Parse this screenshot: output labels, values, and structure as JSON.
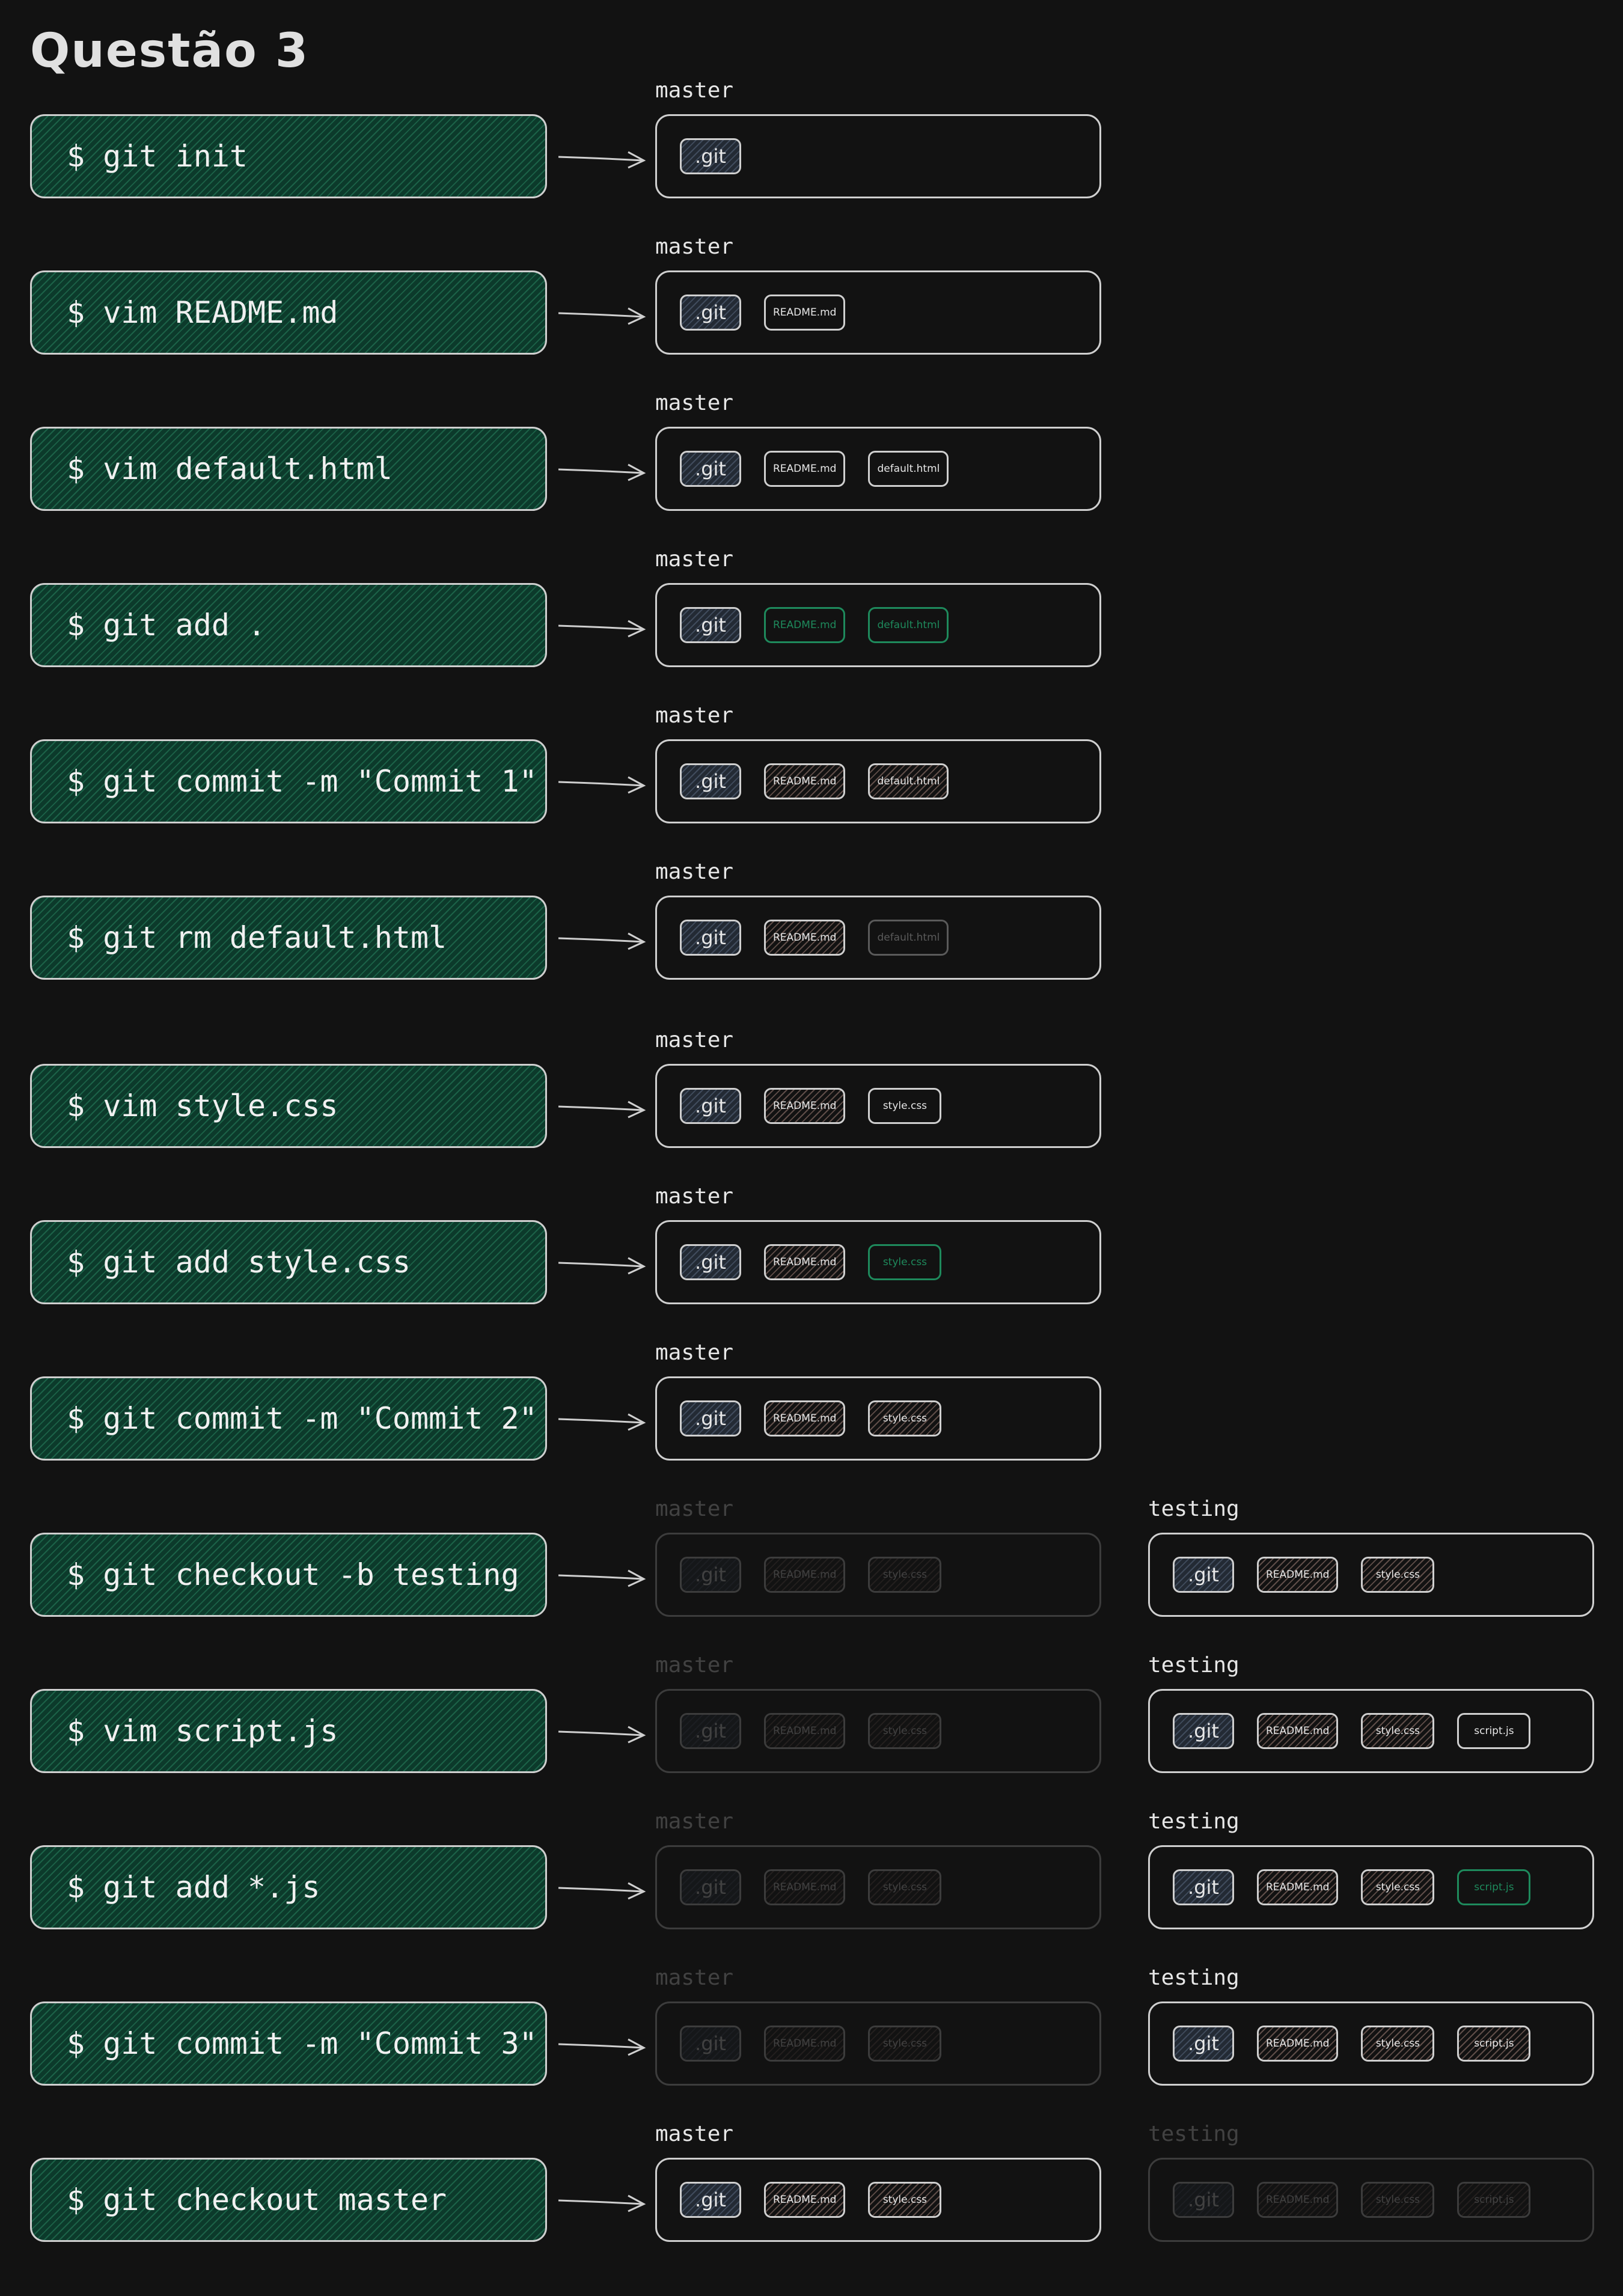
{
  "title": "Questão 3",
  "colors": {
    "background": "#121212",
    "command_fill": "#0c3a2b",
    "staged": "#1e8a5c",
    "border": "#cfcfcf"
  },
  "steps": [
    {
      "command": "$ git init",
      "branches": [
        {
          "name": "master",
          "active": true,
          "files": [
            {
              "name": ".git",
              "state": "git"
            }
          ]
        }
      ]
    },
    {
      "command": "$ vim README.md",
      "branches": [
        {
          "name": "master",
          "active": true,
          "files": [
            {
              "name": ".git",
              "state": "git"
            },
            {
              "name": "README.md",
              "state": "untracked"
            }
          ]
        }
      ]
    },
    {
      "command": "$ vim default.html",
      "branches": [
        {
          "name": "master",
          "active": true,
          "files": [
            {
              "name": ".git",
              "state": "git"
            },
            {
              "name": "README.md",
              "state": "untracked"
            },
            {
              "name": "default.html",
              "state": "untracked"
            }
          ]
        }
      ]
    },
    {
      "command": "$ git add .",
      "branches": [
        {
          "name": "master",
          "active": true,
          "files": [
            {
              "name": ".git",
              "state": "git"
            },
            {
              "name": "README.md",
              "state": "staged"
            },
            {
              "name": "default.html",
              "state": "staged"
            }
          ]
        }
      ]
    },
    {
      "command": "$ git commit -m \"Commit 1\"",
      "branches": [
        {
          "name": "master",
          "active": true,
          "files": [
            {
              "name": ".git",
              "state": "git"
            },
            {
              "name": "README.md",
              "state": "committed"
            },
            {
              "name": "default.html",
              "state": "committed"
            }
          ]
        }
      ]
    },
    {
      "command": "$ git rm default.html",
      "branches": [
        {
          "name": "master",
          "active": true,
          "files": [
            {
              "name": ".git",
              "state": "git"
            },
            {
              "name": "README.md",
              "state": "committed"
            },
            {
              "name": "default.html",
              "state": "removed"
            }
          ]
        }
      ]
    },
    {
      "command": "$ vim style.css",
      "branches": [
        {
          "name": "master",
          "active": true,
          "files": [
            {
              "name": ".git",
              "state": "git"
            },
            {
              "name": "README.md",
              "state": "committed"
            },
            {
              "name": "style.css",
              "state": "untracked"
            }
          ]
        }
      ]
    },
    {
      "command": "$ git add style.css",
      "branches": [
        {
          "name": "master",
          "active": true,
          "files": [
            {
              "name": ".git",
              "state": "git"
            },
            {
              "name": "README.md",
              "state": "committed"
            },
            {
              "name": "style.css",
              "state": "staged"
            }
          ]
        }
      ]
    },
    {
      "command": "$ git commit -m \"Commit 2\"",
      "branches": [
        {
          "name": "master",
          "active": true,
          "files": [
            {
              "name": ".git",
              "state": "git"
            },
            {
              "name": "README.md",
              "state": "committed"
            },
            {
              "name": "style.css",
              "state": "committed"
            }
          ]
        }
      ]
    },
    {
      "command": "$ git checkout -b testing",
      "branches": [
        {
          "name": "master",
          "active": false,
          "files": [
            {
              "name": ".git",
              "state": "git"
            },
            {
              "name": "README.md",
              "state": "committed"
            },
            {
              "name": "style.css",
              "state": "committed"
            }
          ]
        },
        {
          "name": "testing",
          "active": true,
          "files": [
            {
              "name": ".git",
              "state": "git"
            },
            {
              "name": "README.md",
              "state": "committed"
            },
            {
              "name": "style.css",
              "state": "committed"
            }
          ]
        }
      ]
    },
    {
      "command": "$ vim script.js",
      "branches": [
        {
          "name": "master",
          "active": false,
          "files": [
            {
              "name": ".git",
              "state": "git"
            },
            {
              "name": "README.md",
              "state": "committed"
            },
            {
              "name": "style.css",
              "state": "committed"
            }
          ]
        },
        {
          "name": "testing",
          "active": true,
          "files": [
            {
              "name": ".git",
              "state": "git"
            },
            {
              "name": "README.md",
              "state": "committed"
            },
            {
              "name": "style.css",
              "state": "committed"
            },
            {
              "name": "script.js",
              "state": "untracked"
            }
          ]
        }
      ]
    },
    {
      "command": "$ git add *.js",
      "branches": [
        {
          "name": "master",
          "active": false,
          "files": [
            {
              "name": ".git",
              "state": "git"
            },
            {
              "name": "README.md",
              "state": "committed"
            },
            {
              "name": "style.css",
              "state": "committed"
            }
          ]
        },
        {
          "name": "testing",
          "active": true,
          "files": [
            {
              "name": ".git",
              "state": "git"
            },
            {
              "name": "README.md",
              "state": "committed"
            },
            {
              "name": "style.css",
              "state": "committed"
            },
            {
              "name": "script.js",
              "state": "staged"
            }
          ]
        }
      ]
    },
    {
      "command": "$ git commit -m \"Commit 3\"",
      "branches": [
        {
          "name": "master",
          "active": false,
          "files": [
            {
              "name": ".git",
              "state": "git"
            },
            {
              "name": "README.md",
              "state": "committed"
            },
            {
              "name": "style.css",
              "state": "committed"
            }
          ]
        },
        {
          "name": "testing",
          "active": true,
          "files": [
            {
              "name": ".git",
              "state": "git"
            },
            {
              "name": "README.md",
              "state": "committed"
            },
            {
              "name": "style.css",
              "state": "committed"
            },
            {
              "name": "script.js",
              "state": "committed"
            }
          ]
        }
      ]
    },
    {
      "command": "$ git checkout master",
      "branches": [
        {
          "name": "master",
          "active": true,
          "files": [
            {
              "name": ".git",
              "state": "git"
            },
            {
              "name": "README.md",
              "state": "committed"
            },
            {
              "name": "style.css",
              "state": "committed"
            }
          ]
        },
        {
          "name": "testing",
          "active": false,
          "files": [
            {
              "name": ".git",
              "state": "git"
            },
            {
              "name": "README.md",
              "state": "committed"
            },
            {
              "name": "style.css",
              "state": "committed"
            },
            {
              "name": "script.js",
              "state": "committed"
            }
          ]
        }
      ]
    }
  ]
}
